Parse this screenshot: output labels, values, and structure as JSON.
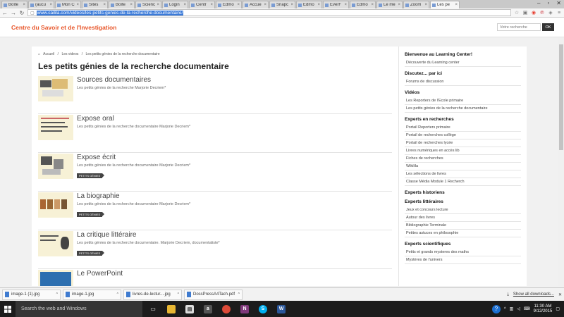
{
  "browser": {
    "tabs": [
      {
        "label": "Boîte"
      },
      {
        "label": "(aucu"
      },
      {
        "label": "Mon C"
      },
      {
        "label": "Sites"
      },
      {
        "label": "Boîte"
      },
      {
        "label": "Scienc"
      },
      {
        "label": "Login"
      },
      {
        "label": "Centr"
      },
      {
        "label": "Edmo"
      },
      {
        "label": "Accue"
      },
      {
        "label": "Snapc"
      },
      {
        "label": "Edmo"
      },
      {
        "label": "EverF"
      },
      {
        "label": "Edmo"
      },
      {
        "label": "Le mé"
      },
      {
        "label": "Zoom"
      },
      {
        "label": "Les pe"
      }
    ],
    "url": "www.cailila.com/videos/les-petits-genies-de-la-recherche-documentaire/"
  },
  "header": {
    "brand": "Centre du Savoir et de l'Investigation",
    "search_placeholder": "Votre recherche",
    "search_button": "OK"
  },
  "breadcrumb": [
    "Accueil",
    "/",
    "Les videos",
    "/",
    "Les petits génies de la recherche documentaire"
  ],
  "page_title": "Les petits génies de la recherche documentaire",
  "entries": [
    {
      "title": "Sources documentaires",
      "desc": "Les petits génies de la recherche Marjorie Decriem*",
      "tag": ""
    },
    {
      "title": "Expose oral",
      "desc": "Les petits génies de la recherche documentaire Marjorie Decriem*",
      "tag": ""
    },
    {
      "title": "Expose écrit",
      "desc": "Les petits génies de la recherche documentaire Marjorie Decriem*",
      "tag": "PETITS GÉNIES"
    },
    {
      "title": "La biographie",
      "desc": "Les petits génies de la recherche documentaire Marjorie Decriem*",
      "tag": "PETITS GÉNIES"
    },
    {
      "title": "La critique littéraire",
      "desc": "Les petits génies de la recherche documentaire. Marjorie Decriem, documentaliste*",
      "tag": "PETITS GÉNIES"
    },
    {
      "title": "Le PowerPoint",
      "desc": "",
      "tag": ""
    }
  ],
  "sidebar": {
    "sections": [
      {
        "title": "Bienvenue au Learning Center!",
        "items": [
          "Découverte du Learning center"
        ]
      },
      {
        "title": "Discutez... par ici",
        "items": [
          "Forums de discussion"
        ]
      },
      {
        "title": "Vidéos",
        "items": [
          "Les Reporters de l'Ecole primaire",
          "Les petits génies de la recherche documentaire"
        ]
      },
      {
        "title": "Experts en recherches",
        "items": [
          "Portail Reporters primaire",
          "Portail de recherches collège",
          "Portail de recherches lycée",
          "Livres numériques en accès lib",
          "Fiches de recherches",
          "Wikilila",
          "Les sélections de livres",
          "Classe Média Module 1 Recherch"
        ]
      },
      {
        "title": "Experts historiens",
        "items": []
      },
      {
        "title": "Experts littéraires",
        "items": [
          "Jeux et concours lecture",
          "Autour des livres",
          "Bibliographie Terminale",
          "Petites astuces en philosophie"
        ]
      },
      {
        "title": "Experts scientifiques",
        "items": [
          "Petits et grands mysteres des maths",
          "Mystères de l'univers"
        ]
      }
    ]
  },
  "downloads": {
    "files": [
      "image-1 (1).jpg",
      "image-1.jpg",
      "livres-de-lectur....jpg",
      "DossPressA4Tach.pdf"
    ],
    "show_all": "Show all downloads..."
  },
  "taskbar": {
    "search": "Search the web and Windows",
    "time": "11:30 AM",
    "date": "9/12/2015"
  }
}
